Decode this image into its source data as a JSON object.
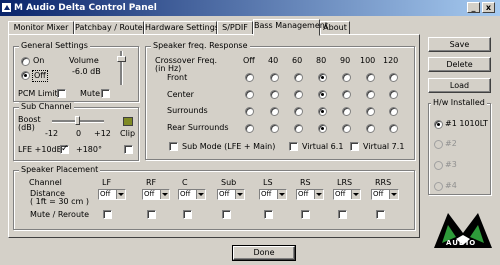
{
  "window": {
    "title": "M Audio Delta Control Panel",
    "min_glyph": "_",
    "close_glyph": "x"
  },
  "tabs": [
    "Monitor Mixer",
    "Patchbay / Router",
    "Hardware Settings",
    "S/PDIF",
    "Bass Management",
    "About"
  ],
  "active_tab": "Bass Management",
  "general": {
    "title": "General Settings",
    "on_label": "On",
    "off_label": "Off",
    "selected": "Off",
    "volume_label": "Volume",
    "volume_value": "-6.0 dB",
    "pcm_limit_label": "PCM Limit",
    "pcm_limit": false,
    "mute_label": "Mute",
    "mute": false
  },
  "sub_channel": {
    "title": "Sub Channel",
    "boost_label": "Boost",
    "boost_unit": "(dB)",
    "ticks": [
      "-12",
      "0",
      "+12"
    ],
    "clip_label": "Clip",
    "lfe_label": "LFE +10dB",
    "lfe": true,
    "phase_label": "+180°",
    "phase": false
  },
  "speaker_freq": {
    "title": "Speaker freq. Response",
    "crossover_label": "Crossover Freq.",
    "crossover_unit": "(in Hz)",
    "columns": [
      "Off",
      "40",
      "60",
      "80",
      "90",
      "100",
      "120"
    ],
    "rows": [
      {
        "label": "Front",
        "selected": 3
      },
      {
        "label": "Center",
        "selected": 3
      },
      {
        "label": "Surrounds",
        "selected": 3
      },
      {
        "label": "Rear Surrounds",
        "selected": 3
      }
    ],
    "sub_mode_label": "Sub Mode (LFE + Main)",
    "sub_mode": false,
    "virtual61_label": "Virtual 6.1",
    "virtual61": false,
    "virtual71_label": "Virtual 7.1",
    "virtual71": false
  },
  "placement": {
    "title": "Speaker Placement",
    "channel_label": "Channel",
    "distance_label": "Distance",
    "distance_unit": "( 1ft = 30 cm )",
    "mute_label": "Mute / Reroute",
    "channels": [
      "LF",
      "RF",
      "C",
      "Sub",
      "LS",
      "RS",
      "LRS",
      "RRS"
    ],
    "distance_values": [
      "Off",
      "Off",
      "Off",
      "Off",
      "Off",
      "Off",
      "Off",
      "Off"
    ]
  },
  "side_buttons": {
    "save": "Save",
    "delete": "Delete",
    "load": "Load"
  },
  "hw_installed": {
    "title": "H/w Installed",
    "items": [
      "#1 1010LT",
      "#2",
      "#3",
      "#4"
    ],
    "selected": 0
  },
  "logo_text": "AUDIO",
  "done_label": "Done"
}
